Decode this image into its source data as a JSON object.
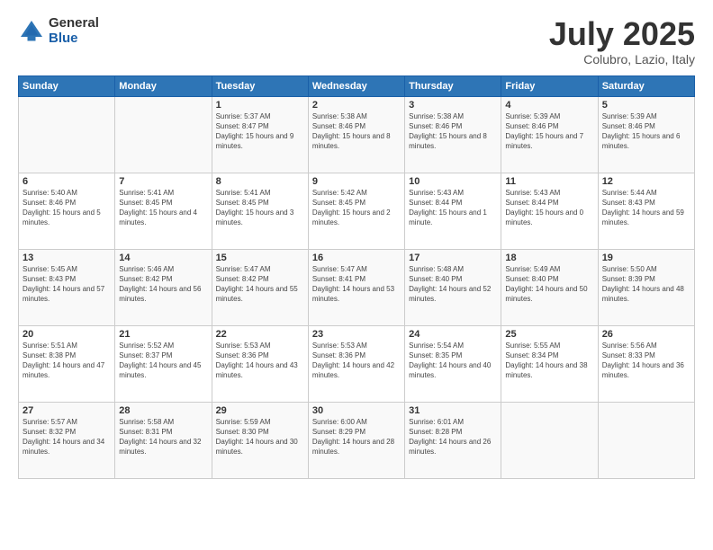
{
  "logo": {
    "general": "General",
    "blue": "Blue"
  },
  "title": "July 2025",
  "location": "Colubro, Lazio, Italy",
  "days_of_week": [
    "Sunday",
    "Monday",
    "Tuesday",
    "Wednesday",
    "Thursday",
    "Friday",
    "Saturday"
  ],
  "weeks": [
    [
      {
        "day": "",
        "info": ""
      },
      {
        "day": "",
        "info": ""
      },
      {
        "day": "1",
        "info": "Sunrise: 5:37 AM\nSunset: 8:47 PM\nDaylight: 15 hours and 9 minutes."
      },
      {
        "day": "2",
        "info": "Sunrise: 5:38 AM\nSunset: 8:46 PM\nDaylight: 15 hours and 8 minutes."
      },
      {
        "day": "3",
        "info": "Sunrise: 5:38 AM\nSunset: 8:46 PM\nDaylight: 15 hours and 8 minutes."
      },
      {
        "day": "4",
        "info": "Sunrise: 5:39 AM\nSunset: 8:46 PM\nDaylight: 15 hours and 7 minutes."
      },
      {
        "day": "5",
        "info": "Sunrise: 5:39 AM\nSunset: 8:46 PM\nDaylight: 15 hours and 6 minutes."
      }
    ],
    [
      {
        "day": "6",
        "info": "Sunrise: 5:40 AM\nSunset: 8:46 PM\nDaylight: 15 hours and 5 minutes."
      },
      {
        "day": "7",
        "info": "Sunrise: 5:41 AM\nSunset: 8:45 PM\nDaylight: 15 hours and 4 minutes."
      },
      {
        "day": "8",
        "info": "Sunrise: 5:41 AM\nSunset: 8:45 PM\nDaylight: 15 hours and 3 minutes."
      },
      {
        "day": "9",
        "info": "Sunrise: 5:42 AM\nSunset: 8:45 PM\nDaylight: 15 hours and 2 minutes."
      },
      {
        "day": "10",
        "info": "Sunrise: 5:43 AM\nSunset: 8:44 PM\nDaylight: 15 hours and 1 minute."
      },
      {
        "day": "11",
        "info": "Sunrise: 5:43 AM\nSunset: 8:44 PM\nDaylight: 15 hours and 0 minutes."
      },
      {
        "day": "12",
        "info": "Sunrise: 5:44 AM\nSunset: 8:43 PM\nDaylight: 14 hours and 59 minutes."
      }
    ],
    [
      {
        "day": "13",
        "info": "Sunrise: 5:45 AM\nSunset: 8:43 PM\nDaylight: 14 hours and 57 minutes."
      },
      {
        "day": "14",
        "info": "Sunrise: 5:46 AM\nSunset: 8:42 PM\nDaylight: 14 hours and 56 minutes."
      },
      {
        "day": "15",
        "info": "Sunrise: 5:47 AM\nSunset: 8:42 PM\nDaylight: 14 hours and 55 minutes."
      },
      {
        "day": "16",
        "info": "Sunrise: 5:47 AM\nSunset: 8:41 PM\nDaylight: 14 hours and 53 minutes."
      },
      {
        "day": "17",
        "info": "Sunrise: 5:48 AM\nSunset: 8:40 PM\nDaylight: 14 hours and 52 minutes."
      },
      {
        "day": "18",
        "info": "Sunrise: 5:49 AM\nSunset: 8:40 PM\nDaylight: 14 hours and 50 minutes."
      },
      {
        "day": "19",
        "info": "Sunrise: 5:50 AM\nSunset: 8:39 PM\nDaylight: 14 hours and 48 minutes."
      }
    ],
    [
      {
        "day": "20",
        "info": "Sunrise: 5:51 AM\nSunset: 8:38 PM\nDaylight: 14 hours and 47 minutes."
      },
      {
        "day": "21",
        "info": "Sunrise: 5:52 AM\nSunset: 8:37 PM\nDaylight: 14 hours and 45 minutes."
      },
      {
        "day": "22",
        "info": "Sunrise: 5:53 AM\nSunset: 8:36 PM\nDaylight: 14 hours and 43 minutes."
      },
      {
        "day": "23",
        "info": "Sunrise: 5:53 AM\nSunset: 8:36 PM\nDaylight: 14 hours and 42 minutes."
      },
      {
        "day": "24",
        "info": "Sunrise: 5:54 AM\nSunset: 8:35 PM\nDaylight: 14 hours and 40 minutes."
      },
      {
        "day": "25",
        "info": "Sunrise: 5:55 AM\nSunset: 8:34 PM\nDaylight: 14 hours and 38 minutes."
      },
      {
        "day": "26",
        "info": "Sunrise: 5:56 AM\nSunset: 8:33 PM\nDaylight: 14 hours and 36 minutes."
      }
    ],
    [
      {
        "day": "27",
        "info": "Sunrise: 5:57 AM\nSunset: 8:32 PM\nDaylight: 14 hours and 34 minutes."
      },
      {
        "day": "28",
        "info": "Sunrise: 5:58 AM\nSunset: 8:31 PM\nDaylight: 14 hours and 32 minutes."
      },
      {
        "day": "29",
        "info": "Sunrise: 5:59 AM\nSunset: 8:30 PM\nDaylight: 14 hours and 30 minutes."
      },
      {
        "day": "30",
        "info": "Sunrise: 6:00 AM\nSunset: 8:29 PM\nDaylight: 14 hours and 28 minutes."
      },
      {
        "day": "31",
        "info": "Sunrise: 6:01 AM\nSunset: 8:28 PM\nDaylight: 14 hours and 26 minutes."
      },
      {
        "day": "",
        "info": ""
      },
      {
        "day": "",
        "info": ""
      }
    ]
  ]
}
